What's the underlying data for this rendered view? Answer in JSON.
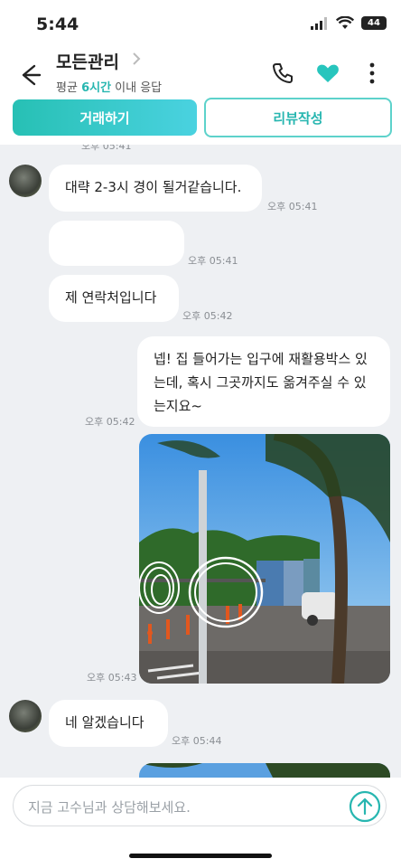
{
  "status": {
    "time": "5:44",
    "battery": "44"
  },
  "header": {
    "title": "모든관리",
    "subtitle_prefix": "평균 ",
    "subtitle_highlight": "6시간",
    "subtitle_suffix": " 이내 응답",
    "accent_color": "#27b6b0"
  },
  "actions": {
    "primary": "거래하기",
    "secondary": "리뷰작성"
  },
  "messages": {
    "m1": {
      "text": "대략 2-3시 경이 될거같습니다.",
      "time": "오후 05:41"
    },
    "m2": {
      "text": "",
      "time": "오후 05:41"
    },
    "m3": {
      "text": "제 연락처입니다",
      "time": "오후 05:42"
    },
    "m4": {
      "text": "넵! 집 들어가는 입구에 재활용박스 있는데, 혹시 그곳까지도 옮겨주실 수 있는지요~",
      "time": "오후 05:42"
    },
    "m5": {
      "time": "오후 05:43"
    },
    "m6": {
      "text": "네 알겠습니다",
      "time": "오후 05:44"
    }
  },
  "composer": {
    "placeholder": "지금 고수님과 상담해보세요."
  }
}
